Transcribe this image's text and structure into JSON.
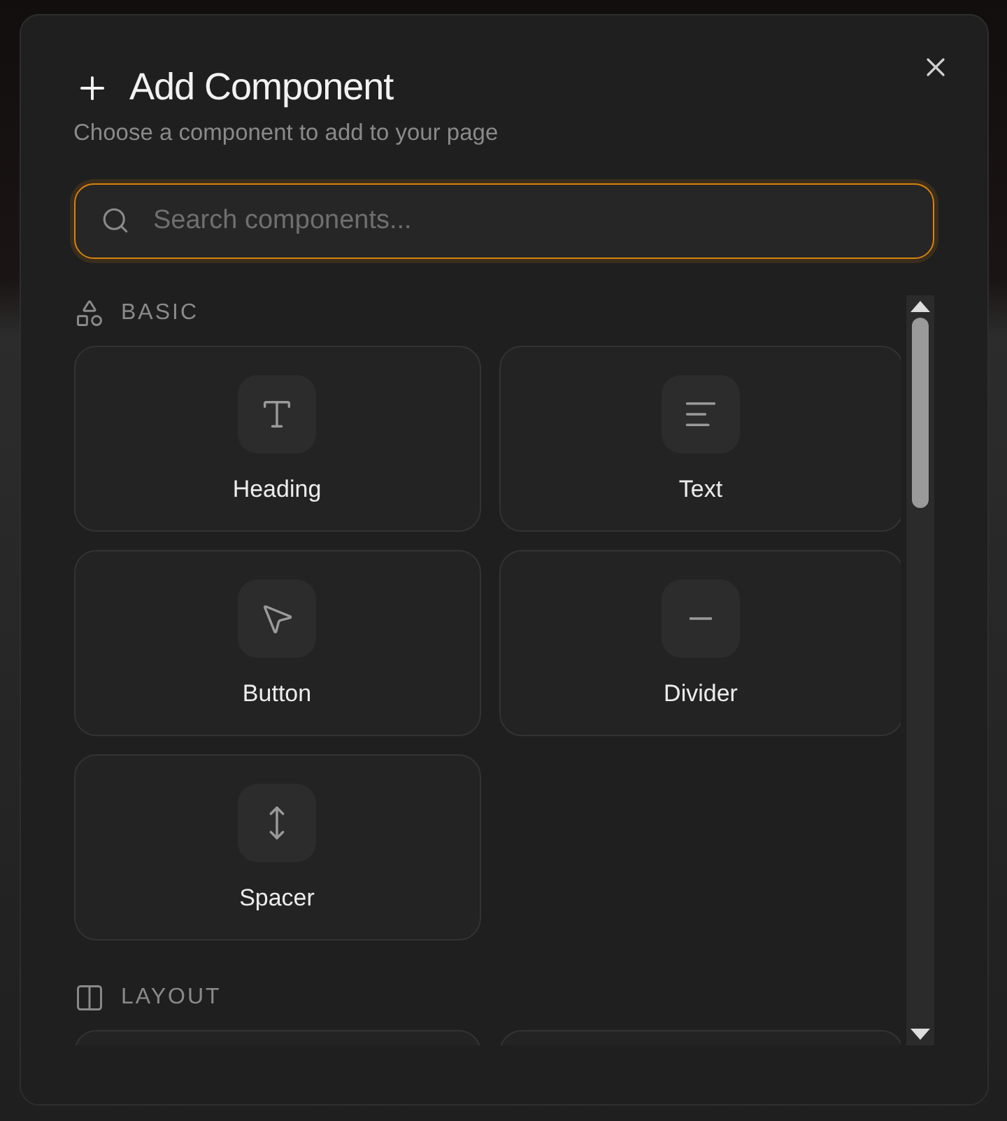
{
  "dialog": {
    "title": "Add Component",
    "subtitle": "Choose a component to add to your page"
  },
  "search": {
    "placeholder": "Search components...",
    "focused": true
  },
  "sections": [
    {
      "label": "BASIC",
      "kind": "basic",
      "items": [
        {
          "kind": "heading",
          "label": "Heading"
        },
        {
          "kind": "text",
          "label": "Text"
        },
        {
          "kind": "button",
          "label": "Button"
        },
        {
          "kind": "divider",
          "label": "Divider"
        },
        {
          "kind": "spacer",
          "label": "Spacer"
        }
      ]
    },
    {
      "label": "LAYOUT",
      "kind": "layout",
      "items": [
        {
          "kind": "clipped"
        },
        {
          "kind": "clipped"
        }
      ]
    }
  ]
}
